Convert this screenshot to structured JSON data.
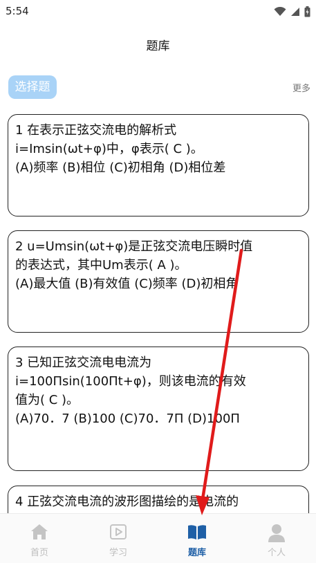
{
  "status_bar": {
    "time": "5:54"
  },
  "header": {
    "title": "题库"
  },
  "category": {
    "label": "选择题",
    "more": "更多"
  },
  "questions": [
    {
      "text": "1 在表示正弦交流电的解析式\ni=Imsin(ωt+φ)中，φ表示( C )。",
      "options": "(A)频率 (B)相位 (C)初相角 (D)相位差"
    },
    {
      "text": "2 u=Umsin(ωt+φ)是正弦交流电压瞬时值\n的表达式，其中Um表示( A )。",
      "options": "(A)最大值 (B)有效值 (C)频率 (D)初相角"
    },
    {
      "text": "3 已知正弦交流电电流为\ni=100Πsin(100Πt+φ)，则该电流的有效\n值为( C )。",
      "options": "(A)70．7 (B)100 (C)70．7Π (D)100Π"
    },
    {
      "text": "4 正弦交流电流的波形图描绘的是电流的",
      "options": ""
    }
  ],
  "bottom_nav": [
    {
      "label": "首页",
      "icon": "home-icon",
      "active": false
    },
    {
      "label": "学习",
      "icon": "video-play-icon",
      "active": false
    },
    {
      "label": "题库",
      "icon": "book-icon",
      "active": true
    },
    {
      "label": "个人",
      "icon": "person-icon",
      "active": false
    }
  ],
  "colors": {
    "accent": "#1e5fa6",
    "chip": "#a9d3f7",
    "annotation_arrow": "#e01b1b",
    "nav_inactive": "#bdbdbd"
  }
}
